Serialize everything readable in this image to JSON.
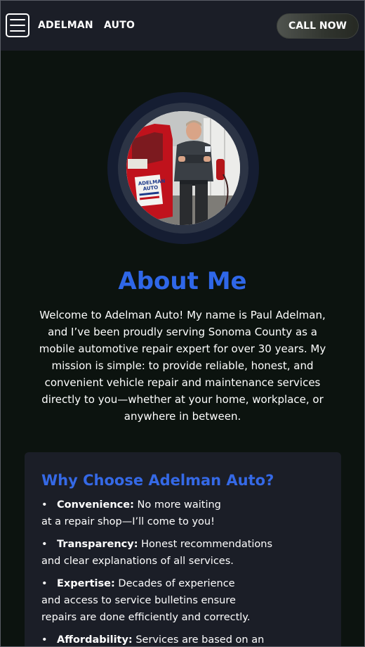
{
  "header": {
    "brand": "ADELMAN   AUTO",
    "call_button": "CALL NOW",
    "menu_icon": "hamburger-icon"
  },
  "profile": {
    "photo": "mechanic-portrait",
    "truck_sign_line1": "ADELMAN",
    "truck_sign_line2": "AUTO"
  },
  "about": {
    "title": "About Me",
    "text": "Welcome to Adelman Auto! My name is Paul Adelman, and I’ve been proudly serving Sonoma County as a mobile automotive repair expert for over 30 years. My mission is simple: to provide reliable, honest, and convenient vehicle repair and maintenance services directly to you—whether at your home, workplace, or anywhere in between."
  },
  "why": {
    "title": "Why Choose Adelman Auto?",
    "items": [
      {
        "label": "Convenience:",
        "text": " No more waiting",
        "text2": "at a repair shop—I’ll come to you!"
      },
      {
        "label": "Transparency:",
        "text": " Honest recommendations",
        "text2": "and clear explanations of all services."
      },
      {
        "label": "Expertise:",
        "text": " Decades of experience",
        "text2": "and access to service bulletins ensure",
        "text3": "repairs are done efficiently and correctly."
      },
      {
        "label": "Affordability:",
        "text": " Services are based on an",
        "text2": ""
      }
    ]
  },
  "colors": {
    "accent": "#2f67e8",
    "background": "#0c130f",
    "header": "#1b1e27",
    "card": "#1b1e27"
  }
}
